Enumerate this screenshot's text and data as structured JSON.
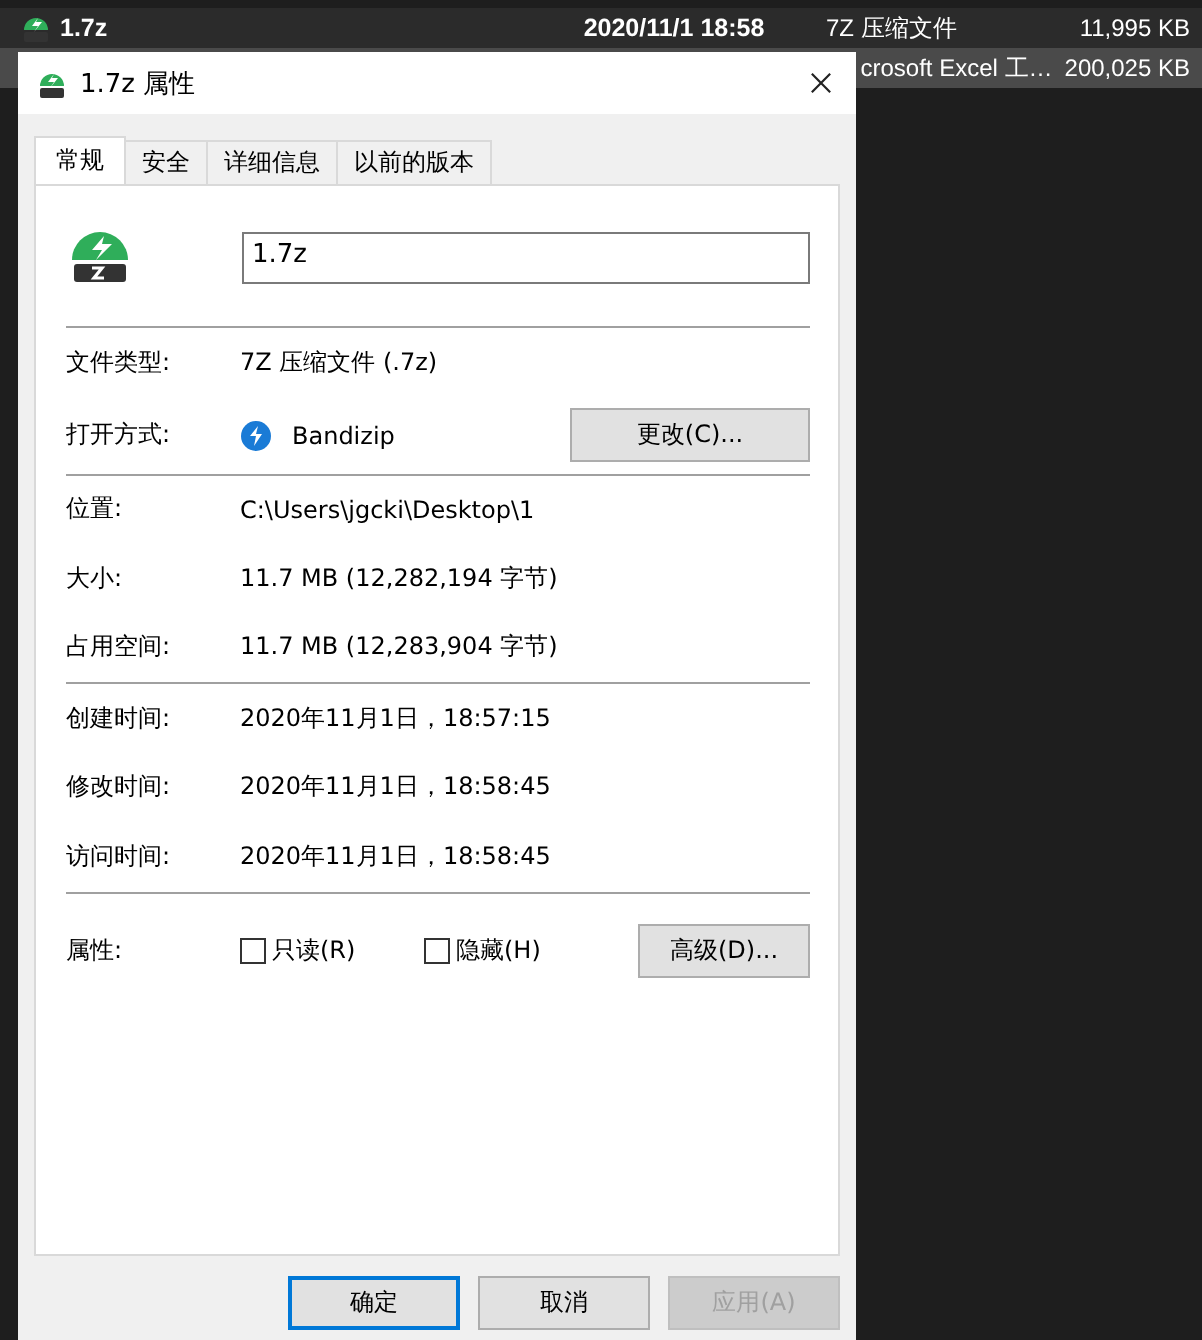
{
  "file_list": {
    "rows": [
      {
        "name": "1.7z",
        "modified": "2020/11/1 18:58",
        "type": "7Z 压缩文件",
        "size": "11,995 KB",
        "selected": false
      },
      {
        "type": "crosoft Excel 工…",
        "size": "200,025 KB",
        "selected": true
      }
    ]
  },
  "dialog": {
    "title": "1.7z 属性",
    "tabs": [
      {
        "label": "常规",
        "selected": true
      },
      {
        "label": "安全",
        "selected": false
      },
      {
        "label": "详细信息",
        "selected": false
      },
      {
        "label": "以前的版本",
        "selected": false
      }
    ],
    "file_name": "1.7z",
    "file_type": {
      "label": "文件类型:",
      "value": "7Z 压缩文件 (.7z)"
    },
    "open_with": {
      "label": "打开方式:",
      "app": "Bandizip",
      "button": "更改(C)..."
    },
    "groups": [
      [
        {
          "label": "位置:",
          "value": "C:\\Users\\jgcki\\Desktop\\1"
        },
        {
          "label": "大小:",
          "value": "11.7 MB (12,282,194 字节)"
        },
        {
          "label": "占用空间:",
          "value": "11.7 MB (12,283,904 字节)"
        }
      ],
      [
        {
          "label": "创建时间:",
          "value": "2020年11月1日，18:57:15"
        },
        {
          "label": "修改时间:",
          "value": "2020年11月1日，18:58:45"
        },
        {
          "label": "访问时间:",
          "value": "2020年11月1日，18:58:45"
        }
      ]
    ],
    "attributes": {
      "label": "属性:",
      "checkboxes": [
        {
          "label": "只读(R)",
          "checked": false
        },
        {
          "label": "隐藏(H)",
          "checked": false
        }
      ],
      "button": "高级(D)..."
    },
    "buttons": [
      {
        "label": "确定",
        "default": true,
        "disabled": false
      },
      {
        "label": "取消",
        "default": false,
        "disabled": false
      },
      {
        "label": "应用(A)",
        "default": false,
        "disabled": true
      }
    ]
  }
}
